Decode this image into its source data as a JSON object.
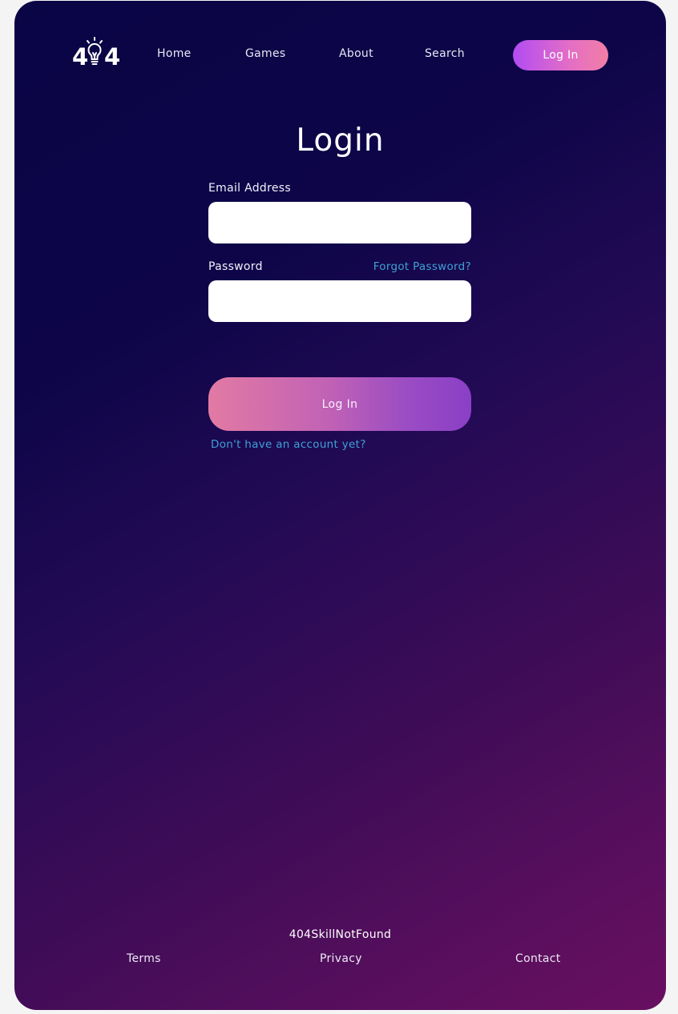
{
  "brand": {
    "logo_text_left": "4",
    "logo_text_right": "4",
    "logo_icon": "lightbulb-icon"
  },
  "nav": {
    "items": [
      {
        "label": "Home"
      },
      {
        "label": "Games"
      },
      {
        "label": "About"
      },
      {
        "label": "Search"
      }
    ],
    "login_label": "Log In"
  },
  "form": {
    "title": "Login",
    "email_label": "Email Address",
    "email_value": "",
    "password_label": "Password",
    "password_value": "",
    "forgot_label": "Forgot Password?",
    "submit_label": "Log In",
    "signup_link": "Don't have an account yet?"
  },
  "footer": {
    "brand": "404SkillNotFound",
    "links": [
      {
        "label": "Terms"
      },
      {
        "label": "Privacy"
      },
      {
        "label": "Contact"
      }
    ]
  },
  "colors": {
    "background_start": "#0a0545",
    "background_end": "#680f60",
    "accent_link": "#3fa1d6",
    "button_gradient_start": "#e27aa3",
    "button_gradient_end": "#8a3fc6",
    "nav_button_start": "#b24cf3",
    "nav_button_end": "#f17fa5"
  }
}
